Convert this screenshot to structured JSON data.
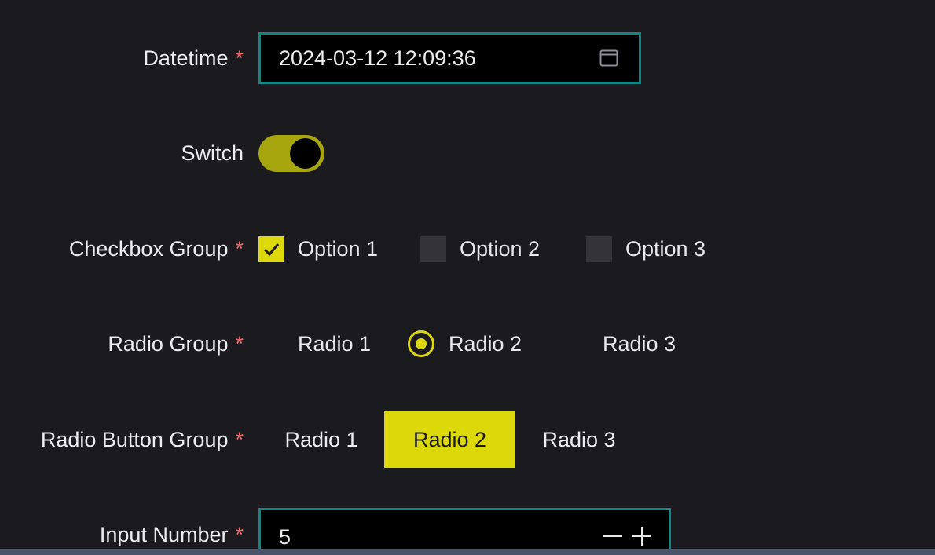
{
  "required_mark": "*",
  "datetime": {
    "label": "Datetime",
    "value": "2024-03-12 12:09:36",
    "icon": "calendar-icon"
  },
  "switch": {
    "label": "Switch",
    "on": true
  },
  "checkbox_group": {
    "label": "Checkbox Group",
    "options": [
      {
        "label": "Option 1",
        "checked": true
      },
      {
        "label": "Option 2",
        "checked": false
      },
      {
        "label": "Option 3",
        "checked": false
      }
    ]
  },
  "radio_group": {
    "label": "Radio Group",
    "options": [
      {
        "label": "Radio 1",
        "selected": false
      },
      {
        "label": "Radio 2",
        "selected": true
      },
      {
        "label": "Radio 3",
        "selected": false
      }
    ]
  },
  "radio_button_group": {
    "label": "Radio Button Group",
    "options": [
      {
        "label": "Radio 1",
        "selected": false
      },
      {
        "label": "Radio 2",
        "selected": true
      },
      {
        "label": "Radio 3",
        "selected": false
      }
    ]
  },
  "input_number": {
    "label": "Input Number",
    "value": "5",
    "decrement": "minus-icon",
    "increment": "plus-icon"
  },
  "colors": {
    "background": "#1b1b1f",
    "accent": "#dcd80a",
    "focus_border": "#138584",
    "required": "#f26b6b"
  }
}
